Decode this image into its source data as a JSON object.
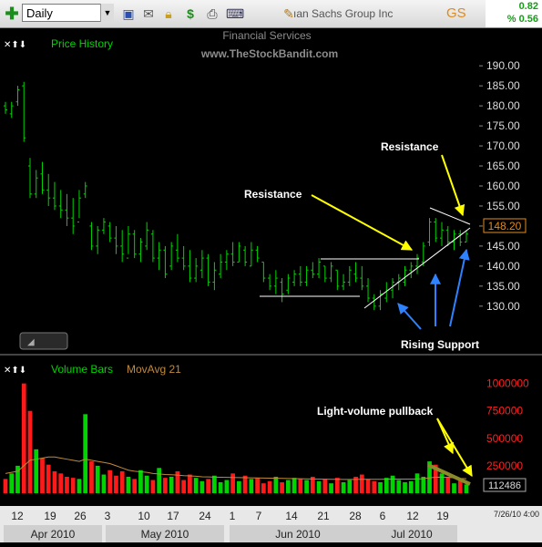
{
  "toolbar": {
    "period": "Daily",
    "company": "ıan Sachs Group Inc",
    "ticker": "GS",
    "change": "0.82",
    "percent_change": "% 0.56"
  },
  "price_panel": {
    "controls": "✕⬆⬇",
    "title": "Price History",
    "sector": "Financial Services",
    "watermark": "www.TheStockBandit.com",
    "last_price": "148.20",
    "annotations": {
      "resistance_1": "Resistance",
      "resistance_2": "Resistance",
      "rising_support": "Rising Support"
    }
  },
  "volume_panel": {
    "controls": "✕⬆⬇",
    "title": "Volume Bars",
    "indicator": "MovAvg 21",
    "last_volume": "112486",
    "annotation": "Light-volume pullback"
  },
  "date_axis": {
    "days": [
      "12",
      "19",
      "26",
      "3",
      "10",
      "17",
      "24",
      "1",
      "7",
      "14",
      "21",
      "28",
      "6",
      "12",
      "19"
    ],
    "months": [
      "Apr 2010",
      "May 2010",
      "Jun 2010",
      "Jul 2010"
    ],
    "timestamp": "7/26/10 4:00"
  },
  "colors": {
    "up": "#00d400",
    "down": "#ff1a1a",
    "annotation_yellow": "#ffff00",
    "arrow_blue": "#2f82ff",
    "avg_line": "#c08a3a",
    "ticker": "#e08a1e"
  },
  "chart_data": [
    {
      "type": "ohlc",
      "y_axis": {
        "ticks": [
          "190.00",
          "185.00",
          "180.00",
          "175.00",
          "170.00",
          "165.00",
          "160.00",
          "155.00",
          "150.00",
          "145.00",
          "140.00",
          "135.00",
          "130.00"
        ],
        "ylim": [
          127,
          193
        ]
      },
      "bars": [
        {
          "h": 181,
          "l": 178,
          "o": 180,
          "c": 179
        },
        {
          "h": 181,
          "l": 177,
          "o": 178,
          "c": 180
        },
        {
          "h": 185,
          "l": 180,
          "o": 181,
          "c": 184
        },
        {
          "h": 186,
          "l": 171,
          "o": 185,
          "c": 172
        },
        {
          "h": 167,
          "l": 157,
          "o": 165,
          "c": 158
        },
        {
          "h": 164,
          "l": 157,
          "o": 158,
          "c": 162
        },
        {
          "h": 166,
          "l": 158,
          "o": 163,
          "c": 159
        },
        {
          "h": 163,
          "l": 155,
          "o": 159,
          "c": 157
        },
        {
          "h": 161,
          "l": 154,
          "o": 157,
          "c": 155
        },
        {
          "h": 159,
          "l": 152,
          "o": 155,
          "c": 154
        },
        {
          "h": 158,
          "l": 150,
          "o": 154,
          "c": 152
        },
        {
          "h": 157,
          "l": 148,
          "o": 152,
          "c": 150
        },
        {
          "h": 159,
          "l": 152,
          "o": 151,
          "c": 157
        },
        {
          "h": 161,
          "l": 157,
          "o": 158,
          "c": 160
        },
        {
          "h": 151,
          "l": 144,
          "o": 150,
          "c": 145
        },
        {
          "h": 150,
          "l": 143,
          "o": 145,
          "c": 149
        },
        {
          "h": 152,
          "l": 148,
          "o": 149,
          "c": 151
        },
        {
          "h": 151,
          "l": 146,
          "o": 150,
          "c": 147
        },
        {
          "h": 150,
          "l": 143,
          "o": 147,
          "c": 145
        },
        {
          "h": 149,
          "l": 141,
          "o": 145,
          "c": 143
        },
        {
          "h": 150,
          "l": 143,
          "o": 142,
          "c": 148
        },
        {
          "h": 149,
          "l": 142,
          "o": 148,
          "c": 143
        },
        {
          "h": 147,
          "l": 141,
          "o": 143,
          "c": 146
        },
        {
          "h": 151,
          "l": 144,
          "o": 145,
          "c": 149
        },
        {
          "h": 149,
          "l": 141,
          "o": 148,
          "c": 142
        },
        {
          "h": 146,
          "l": 139,
          "o": 142,
          "c": 144
        },
        {
          "h": 145,
          "l": 137,
          "o": 144,
          "c": 138
        },
        {
          "h": 146,
          "l": 139,
          "o": 140,
          "c": 145
        },
        {
          "h": 148,
          "l": 141,
          "o": 144,
          "c": 142
        },
        {
          "h": 145,
          "l": 139,
          "o": 142,
          "c": 140
        },
        {
          "h": 144,
          "l": 136,
          "o": 140,
          "c": 137
        },
        {
          "h": 142,
          "l": 136,
          "o": 137,
          "c": 140
        },
        {
          "h": 144,
          "l": 137,
          "o": 139,
          "c": 142
        },
        {
          "h": 143,
          "l": 135,
          "o": 142,
          "c": 136
        },
        {
          "h": 141,
          "l": 134,
          "o": 136,
          "c": 139
        },
        {
          "h": 143,
          "l": 137,
          "o": 138,
          "c": 141
        },
        {
          "h": 144,
          "l": 139,
          "o": 141,
          "c": 143
        },
        {
          "h": 146,
          "l": 140,
          "o": 143,
          "c": 141
        },
        {
          "h": 146,
          "l": 141,
          "o": 141,
          "c": 145
        },
        {
          "h": 145,
          "l": 140,
          "o": 144,
          "c": 141
        },
        {
          "h": 146,
          "l": 140,
          "o": 140,
          "c": 144
        },
        {
          "h": 145,
          "l": 141,
          "o": 144,
          "c": 142
        },
        {
          "h": 141,
          "l": 136,
          "o": 141,
          "c": 137
        },
        {
          "h": 138,
          "l": 134,
          "o": 137,
          "c": 135
        },
        {
          "h": 139,
          "l": 133,
          "o": 135,
          "c": 137
        },
        {
          "h": 137,
          "l": 131,
          "o": 136,
          "c": 133
        },
        {
          "h": 138,
          "l": 133,
          "o": 134,
          "c": 137
        },
        {
          "h": 139,
          "l": 135,
          "o": 136,
          "c": 138
        },
        {
          "h": 140,
          "l": 135,
          "o": 138,
          "c": 136
        },
        {
          "h": 140,
          "l": 135,
          "o": 136,
          "c": 139
        },
        {
          "h": 141,
          "l": 137,
          "o": 139,
          "c": 138
        },
        {
          "h": 142,
          "l": 137,
          "o": 138,
          "c": 141
        },
        {
          "h": 140,
          "l": 136,
          "o": 140,
          "c": 137
        },
        {
          "h": 141,
          "l": 136,
          "o": 137,
          "c": 140
        },
        {
          "h": 139,
          "l": 134,
          "o": 139,
          "c": 135
        },
        {
          "h": 138,
          "l": 134,
          "o": 135,
          "c": 136
        },
        {
          "h": 140,
          "l": 135,
          "o": 136,
          "c": 139
        },
        {
          "h": 141,
          "l": 136,
          "o": 138,
          "c": 137
        },
        {
          "h": 140,
          "l": 134,
          "o": 137,
          "c": 135
        },
        {
          "h": 137,
          "l": 131,
          "o": 135,
          "c": 132
        },
        {
          "h": 133,
          "l": 129,
          "o": 132,
          "c": 130
        },
        {
          "h": 134,
          "l": 129,
          "o": 130,
          "c": 133
        },
        {
          "h": 136,
          "l": 131,
          "o": 132,
          "c": 134
        },
        {
          "h": 137,
          "l": 132,
          "o": 134,
          "c": 136
        },
        {
          "h": 138,
          "l": 134,
          "o": 136,
          "c": 137
        },
        {
          "h": 140,
          "l": 135,
          "o": 136,
          "c": 139
        },
        {
          "h": 141,
          "l": 137,
          "o": 139,
          "c": 140
        },
        {
          "h": 143,
          "l": 138,
          "o": 140,
          "c": 142
        },
        {
          "h": 146,
          "l": 140,
          "o": 141,
          "c": 145
        },
        {
          "h": 152,
          "l": 145,
          "o": 146,
          "c": 151
        },
        {
          "h": 152,
          "l": 146,
          "o": 151,
          "c": 147
        },
        {
          "h": 151,
          "l": 145,
          "o": 147,
          "c": 149
        },
        {
          "h": 150,
          "l": 145,
          "o": 149,
          "c": 146
        },
        {
          "h": 149,
          "l": 144,
          "o": 146,
          "c": 148
        },
        {
          "h": 149,
          "l": 145,
          "o": 148,
          "c": 146
        },
        {
          "h": 149,
          "l": 146,
          "o": 146,
          "c": 148
        }
      ]
    },
    {
      "type": "bar",
      "series": [
        {
          "name": "Volume Bars",
          "values": [
            130000,
            180000,
            250000,
            1000000,
            750000,
            400000,
            320000,
            260000,
            200000,
            180000,
            150000,
            140000,
            130000,
            720000,
            290000,
            250000,
            170000,
            210000,
            160000,
            200000,
            150000,
            130000,
            210000,
            160000,
            120000,
            230000,
            140000,
            150000,
            200000,
            120000,
            170000,
            140000,
            110000,
            130000,
            160000,
            100000,
            120000,
            180000,
            110000,
            160000,
            130000,
            140000,
            90000,
            110000,
            150000,
            100000,
            120000,
            140000,
            130000,
            120000,
            150000,
            110000,
            130000,
            90000,
            140000,
            100000,
            120000,
            150000,
            170000,
            130000,
            110000,
            100000,
            140000,
            160000,
            120000,
            100000,
            110000,
            180000,
            150000,
            290000,
            260000,
            180000,
            150000,
            90000,
            112486,
            80000
          ]
        },
        {
          "name": "MovAvg 21",
          "values": [
            180000,
            190000,
            200000,
            250000,
            300000,
            310000,
            320000,
            330000,
            330000,
            320000,
            310000,
            300000,
            290000,
            310000,
            300000,
            290000,
            280000,
            270000,
            250000,
            230000,
            210000,
            200000,
            195000,
            190000,
            180000,
            175000,
            170000,
            168000,
            165000,
            160000,
            158000,
            155000,
            150000,
            148000,
            146000,
            145000,
            144000,
            143000,
            142000,
            141000,
            140000,
            139000,
            138000,
            137000,
            136000,
            135000,
            134000,
            133000,
            132000,
            131000,
            130000,
            129000,
            128000,
            127000,
            127000,
            126000,
            126000,
            126000,
            127000,
            127000,
            127000,
            127000,
            128000,
            129000,
            129000,
            129000,
            129000,
            130000,
            132000,
            140000,
            145000,
            146000,
            144000,
            140000,
            135000,
            132000
          ]
        }
      ],
      "y_axis": {
        "ticks": [
          "1000000",
          "750000",
          "500000",
          "250000"
        ],
        "ylim": [
          0,
          1080000
        ]
      }
    }
  ]
}
